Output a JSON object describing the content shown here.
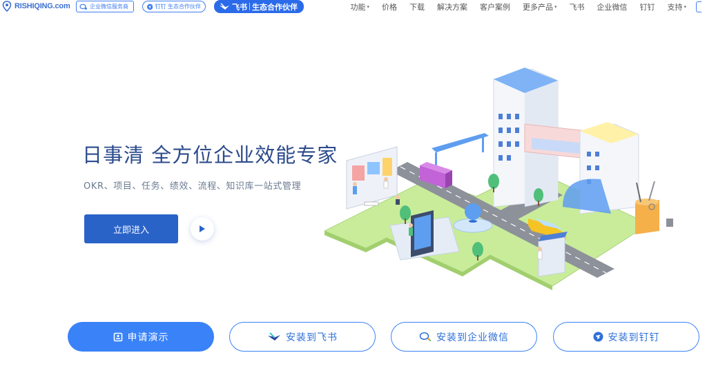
{
  "header": {
    "logo_text": "RISHIQING.com",
    "badges": {
      "wecom": "企业微信服务商",
      "dingtalk": "钉钉 生态合作伙伴",
      "feishu_name": "飞书",
      "feishu_partner": "生态合作伙伴"
    },
    "nav": [
      {
        "label": "功能",
        "dropdown": true
      },
      {
        "label": "价格",
        "dropdown": false
      },
      {
        "label": "下载",
        "dropdown": false
      },
      {
        "label": "解决方案",
        "dropdown": false
      },
      {
        "label": "客户案例",
        "dropdown": false
      },
      {
        "label": "更多产品",
        "dropdown": true
      },
      {
        "label": "飞书",
        "dropdown": false
      },
      {
        "label": "企业微信",
        "dropdown": false
      },
      {
        "label": "钉钉",
        "dropdown": false
      },
      {
        "label": "支持",
        "dropdown": true
      }
    ],
    "caret": "▾"
  },
  "hero": {
    "title": "日事清 全方位企业效能专家",
    "subtitle": "OKR、项目、任务、绩效、流程、知识库一站式管理",
    "cta_label": "立即进入"
  },
  "bottom_actions": {
    "demo": "申请演示",
    "feishu": "安装到飞书",
    "wecom": "安装到企业微信",
    "dingtalk": "安装到钉钉"
  },
  "colors": {
    "brand": "#2a63c8",
    "accent": "#3a82f7",
    "title": "#2c4b8c"
  }
}
